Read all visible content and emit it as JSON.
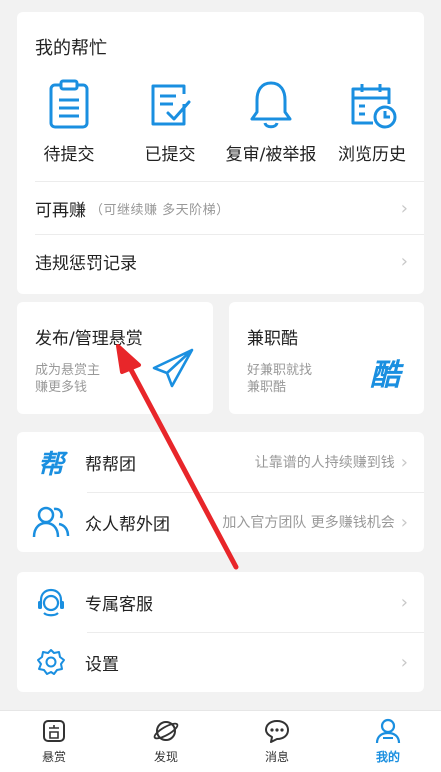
{
  "help": {
    "title": "我的帮忙",
    "items": [
      {
        "label": "待提交",
        "icon": "clipboard-list-icon"
      },
      {
        "label": "已提交",
        "icon": "clipboard-check-icon"
      },
      {
        "label": "复审/被举报",
        "icon": "bell-icon"
      },
      {
        "label": "浏览历史",
        "icon": "calendar-clock-icon"
      }
    ],
    "rows": [
      {
        "title": "可再赚",
        "sub": "（可继续赚 多天阶梯）"
      },
      {
        "title": "违规惩罚记录",
        "sub": ""
      }
    ]
  },
  "promo": {
    "publish": {
      "title": "发布/管理悬赏",
      "desc1": "成为悬赏主",
      "desc2": "赚更多钱",
      "icon": "paper-plane-icon"
    },
    "parttime": {
      "title": "兼职酷",
      "desc1": "好兼职就找",
      "desc2": "兼职酷",
      "icon": "kuo-logo-icon",
      "logo_text": "酷"
    }
  },
  "team": [
    {
      "title": "帮帮团",
      "desc": "让靠谱的人持续赚到钱",
      "icon": "bang-logo-icon",
      "logo_text": "帮"
    },
    {
      "title": "众人帮外团",
      "desc": "加入官方团队 更多赚钱机会",
      "icon": "people-icon"
    }
  ],
  "service": [
    {
      "title": "专属客服",
      "icon": "headset-icon"
    },
    {
      "title": "设置",
      "icon": "gear-icon"
    }
  ],
  "tabs": [
    {
      "label": "悬赏",
      "icon": "reward-icon",
      "active": false
    },
    {
      "label": "发现",
      "icon": "planet-icon",
      "active": false
    },
    {
      "label": "消息",
      "icon": "chat-icon",
      "active": false
    },
    {
      "label": "我的",
      "icon": "user-icon",
      "active": true
    }
  ],
  "colors": {
    "accent": "#1a8fe0",
    "arrow": "#e8262a"
  }
}
